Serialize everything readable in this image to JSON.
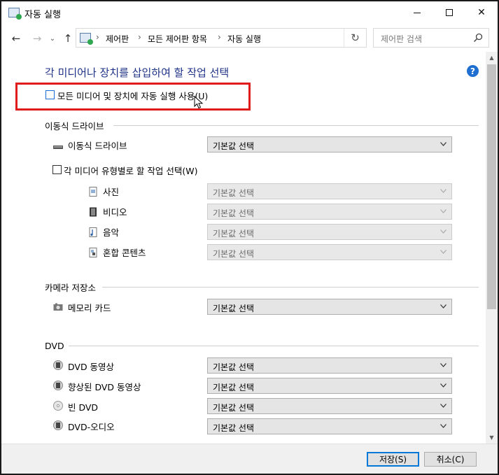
{
  "window": {
    "title": "자동 실행"
  },
  "nav": {
    "breadcrumb": [
      "제어판",
      "모든 제어판 항목",
      "자동 실행"
    ],
    "search_placeholder": "제어판 검색"
  },
  "main": {
    "heading": "각 미디어나 장치를 삽입하여 할 작업 선택",
    "use_autoplay_label": "모든 미디어 및 장치에 자동 실행 사용(U)",
    "use_autoplay_checked": false
  },
  "sections": {
    "removable": {
      "title": "이동식 드라이브",
      "drive_label": "이동식 드라이브",
      "drive_value": "기본값 선택",
      "per_media_label": "각 미디어 유형별로 할 작업 선택(W)",
      "per_media_checked": false,
      "media": [
        {
          "label": "사진",
          "value": "기본값 선택",
          "icon": "photo-file-icon"
        },
        {
          "label": "비디오",
          "value": "기본값 선택",
          "icon": "video-file-icon"
        },
        {
          "label": "음악",
          "value": "기본값 선택",
          "icon": "music-file-icon"
        },
        {
          "label": "혼합 콘텐츠",
          "value": "기본값 선택",
          "icon": "mixed-content-icon"
        }
      ]
    },
    "camera": {
      "title": "카메라 저장소",
      "items": [
        {
          "label": "메모리 카드",
          "value": "기본값 선택",
          "icon": "camera-icon"
        }
      ]
    },
    "dvd": {
      "title": "DVD",
      "items": [
        {
          "label": "DVD 동영상",
          "value": "기본값 선택",
          "icon": "dvd-film-icon"
        },
        {
          "label": "향상된 DVD 동영상",
          "value": "기본값 선택",
          "icon": "dvd-film-icon"
        },
        {
          "label": "빈 DVD",
          "value": "기본값 선택",
          "icon": "blank-disc-icon"
        },
        {
          "label": "DVD-오디오",
          "value": "기본값 선택",
          "icon": "dvd-film-icon"
        }
      ]
    }
  },
  "footer": {
    "save_label": "저장(S)",
    "cancel_label": "취소(C)"
  },
  "colors": {
    "heading": "#1e3287",
    "highlight_border": "#e01b1b",
    "accent": "#0078d7"
  }
}
